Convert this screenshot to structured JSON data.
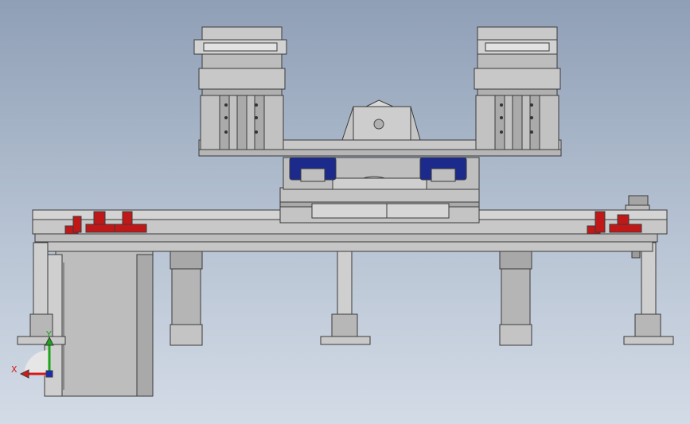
{
  "view": {
    "triad": {
      "x_label": "X",
      "y_label": "Y",
      "x_color": "#d11a1a",
      "y_color": "#1aa51a"
    }
  },
  "colors": {
    "part_gray": "#c4c4c4",
    "part_dark": "#9a9a9a",
    "slider_blue": "#1c2a8c",
    "stopper_red": "#c01818"
  }
}
